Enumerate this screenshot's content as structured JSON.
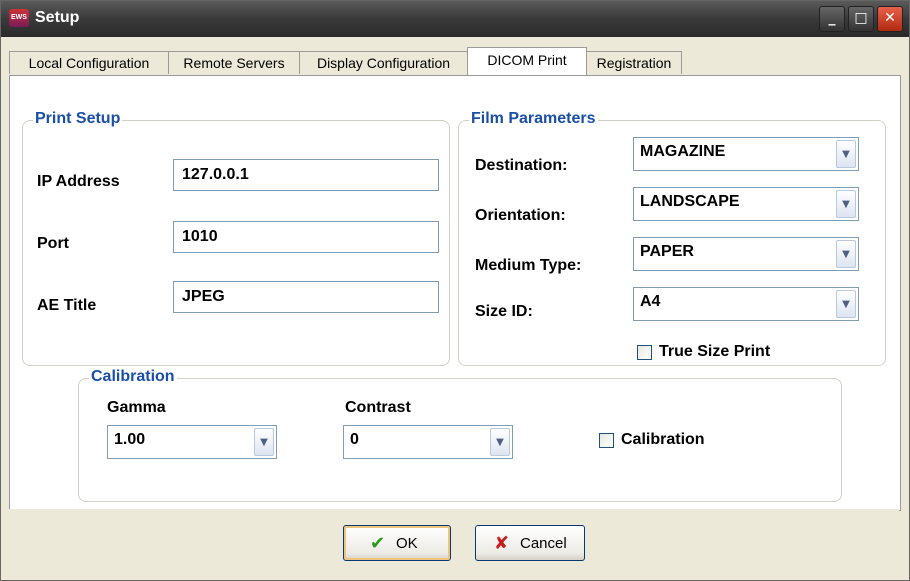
{
  "window": {
    "title": "Setup",
    "app_icon_text": "EWS",
    "buttons": {
      "minimize": "_",
      "maximize": "□",
      "close": "✕"
    }
  },
  "tabs": [
    {
      "label": "Local Configuration",
      "active": false
    },
    {
      "label": "Remote Servers",
      "active": false
    },
    {
      "label": "Display Configuration",
      "active": false
    },
    {
      "label": "DICOM Print",
      "active": true
    },
    {
      "label": "Registration",
      "active": false
    }
  ],
  "print_setup": {
    "title": "Print Setup",
    "ip_label": "IP Address",
    "ip_value": "127.0.0.1",
    "port_label": "Port",
    "port_value": "1010",
    "ae_label": "AE Title",
    "ae_value": "JPEG"
  },
  "film_parameters": {
    "title": "Film Parameters",
    "destination_label": "Destination:",
    "destination_value": "MAGAZINE",
    "orientation_label": "Orientation:",
    "orientation_value": "LANDSCAPE",
    "medium_label": "Medium Type:",
    "medium_value": "PAPER",
    "size_label": "Size ID:",
    "size_value": "A4",
    "true_size_label": "True Size Print",
    "true_size_checked": false
  },
  "calibration": {
    "title": "Calibration",
    "gamma_label": "Gamma",
    "gamma_value": "1.00",
    "contrast_label": "Contrast",
    "contrast_value": "0",
    "calibration_label": "Calibration",
    "calibration_checked": false
  },
  "footer": {
    "ok_label": "OK",
    "cancel_label": "Cancel"
  },
  "icons": {
    "combo_arrow": "▼",
    "ok_icon": "✔",
    "cancel_icon": "✘"
  },
  "colors": {
    "group_title": "#1a4fa8",
    "ok_check": "#2e9a1c",
    "cancel_x": "#c81d1d"
  }
}
